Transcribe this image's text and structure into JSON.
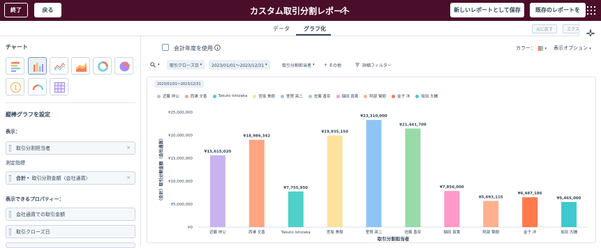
{
  "header": {
    "exit_label": "終了",
    "back_label": "戻る",
    "title": "カスタム取引分割レポート",
    "save_new_label": "新しいレポートとして保存",
    "save_existing_label": "既存のレポートを"
  },
  "tabs": [
    {
      "label": "データ"
    },
    {
      "label": "グラフ化",
      "selected": true
    }
  ],
  "toolbar_right": {
    "undo_label": "元に戻す",
    "export_label": "エクス"
  },
  "sidebar": {
    "chart_title": "チャート",
    "chart_types": [
      "horizontal-bar",
      "vertical-bar",
      "line",
      "area",
      "donut",
      "pie",
      "kpi",
      "gauge",
      "table"
    ],
    "selected_chart_type": "vertical-bar",
    "config_title": "縦棒グラフを設定",
    "display_label": "表示：",
    "display_value": "取引分割担当者",
    "measure_label": "測定指標",
    "measure_agg": "合計",
    "measure_value": "取引分割金額（会社通貨）",
    "props_label": "表示できるプロパティー：",
    "props": [
      "会社通貨での取引金額",
      "取引クローズ日"
    ]
  },
  "main": {
    "fiscal_year_label": "会計年度を使用",
    "color_label": "カラー：",
    "options_label": "表示オプション",
    "filters": {
      "close_date_label": "取引クローズ日",
      "date_range": "2023/01/01〜2023/12/31",
      "owner_label": "取引分割担当者",
      "more_label": "その他",
      "advanced_label": "詳細フィルター"
    },
    "date_chip": "2023/01/01〜2023/12/31"
  },
  "chart_data": {
    "type": "bar",
    "categories": [
      "近藤 祥公",
      "西澤 文香",
      "Takuto Ishizaka",
      "宮坂 美樹",
      "室賀 英二",
      "佐藤 香奈",
      "稲田 真貴",
      "阿部 賢樹",
      "金子 洋",
      "坂田 大輔"
    ],
    "values": [
      15615020,
      18986342,
      7755950,
      19935150,
      23310000,
      21441709,
      7856000,
      5693115,
      6487186,
      5465000
    ],
    "value_labels": [
      "¥15,615,020",
      "¥18,986,342",
      "¥7,755,950",
      "¥19,935,150",
      "¥23,310,000",
      "¥21,441,709",
      "¥7,856,000",
      "¥5,693,115",
      "¥6,487,186",
      "¥5,465,000"
    ],
    "colors": [
      "#c8b2f0",
      "#ffa581",
      "#4fd0c9",
      "#fde29e",
      "#8fc5f5",
      "#96dba8",
      "#ff99c9",
      "#ffb08d",
      "#ff7a4a",
      "#3fc8cf"
    ],
    "xlabel": "取引分割担当者",
    "ylabel": "（合計）取引分割金額（会社通貨）",
    "ylim": [
      0,
      25000000
    ],
    "yticks": [
      0,
      5000000,
      10000000,
      15000000,
      20000000,
      25000000
    ],
    "ytick_labels": [
      "¥0",
      "¥5,000,000",
      "¥10,000,000",
      "¥15,000,000",
      "¥20,000,000",
      "¥25,000,000"
    ],
    "grid": false,
    "legend": "top"
  }
}
